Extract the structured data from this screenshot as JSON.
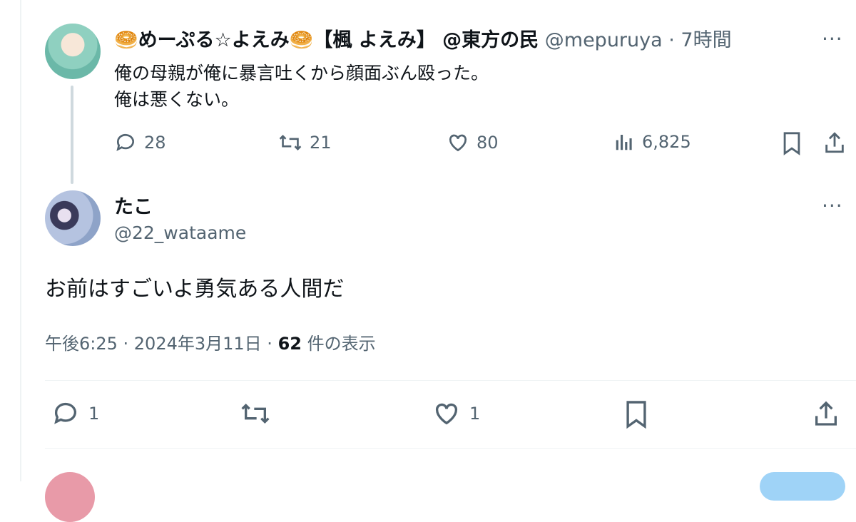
{
  "parent_tweet": {
    "display_name": "🥯めーぷる☆よえみ🥯【楓 よえみ】 @東方の民",
    "handle": "@mepuruya",
    "time": "· 7時間",
    "text_line1": "俺の母親が俺に暴言吐くから顔面ぶん殴った。",
    "text_line2": "俺は悪くない。",
    "more": "···",
    "replies": "28",
    "retweets": "21",
    "likes": "80",
    "views": "6,825"
  },
  "reply_tweet": {
    "display_name": "たこ",
    "handle": "@22_wataame",
    "more": "···",
    "text": "お前はすごいよ勇気ある人間だ",
    "timestamp": "午後6:25 · 2024年3月11日 · ",
    "views_count": "62",
    "views_label": " 件の表示",
    "replies": "1",
    "likes": "1"
  },
  "icons": [
    "reply-icon",
    "retweet-icon",
    "like-icon",
    "views-icon",
    "bookmark-icon",
    "share-icon",
    "more-icon"
  ],
  "colors": {
    "text": "#0f1419",
    "secondary": "#536471",
    "divider": "#eff3f4",
    "thread_line": "#cfd9de"
  }
}
